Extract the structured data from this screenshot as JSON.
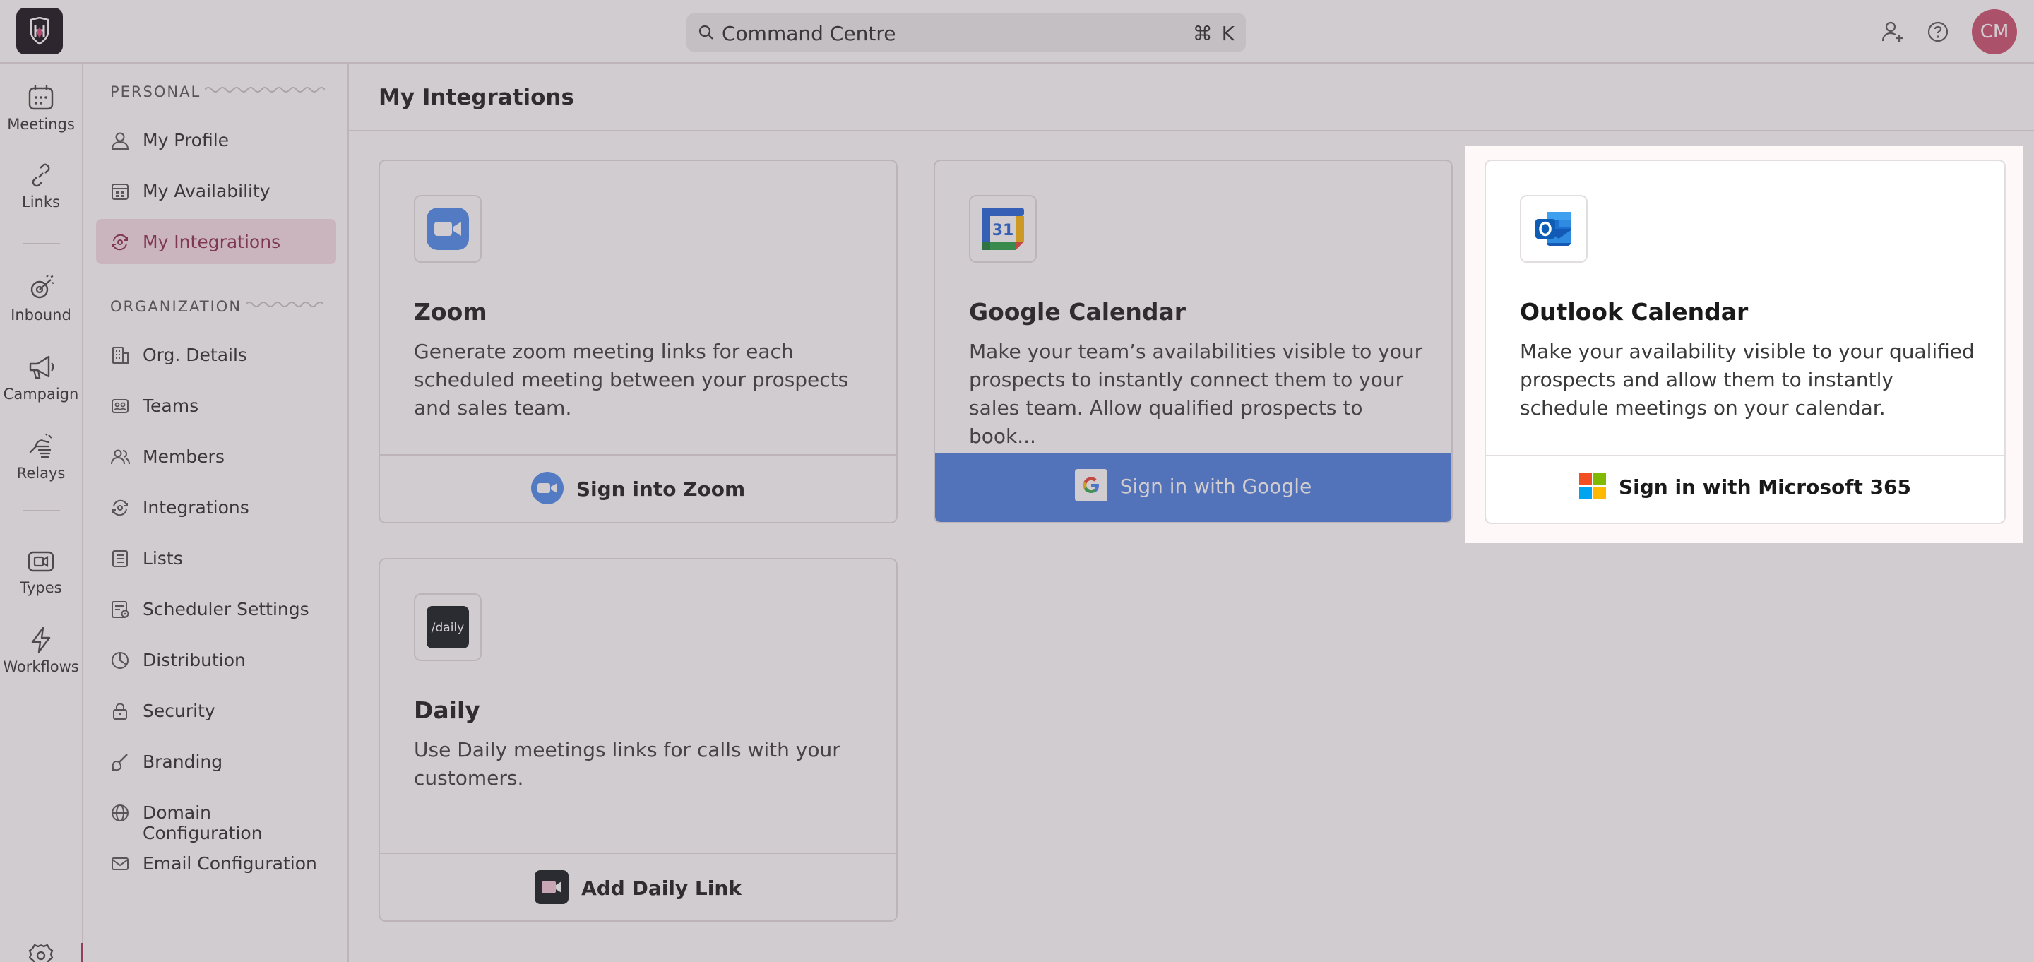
{
  "topbar": {
    "search_text": "Command Centre",
    "shortcut": "⌘ K",
    "avatar_initials": "CM",
    "icons": [
      "logo-icon",
      "search-icon",
      "add-user-icon",
      "help-icon"
    ]
  },
  "rail": {
    "items": [
      {
        "label": "Meetings",
        "icon": "calendar-icon"
      },
      {
        "label": "Links",
        "icon": "link-icon"
      },
      {
        "label": "Inbound",
        "icon": "cursor-click-icon"
      },
      {
        "label": "Campaign",
        "icon": "megaphone-icon"
      },
      {
        "label": "Relays",
        "icon": "hand-icon"
      },
      {
        "label": "Types",
        "icon": "video-icon"
      },
      {
        "label": "Workflows",
        "icon": "bolt-icon"
      }
    ],
    "bottom_icon": "settings-icon"
  },
  "sidebar": {
    "personal_heading": "PERSONAL",
    "organization_heading": "ORGANIZATION",
    "personal": [
      {
        "label": "My Profile",
        "icon": "user-icon"
      },
      {
        "label": "My Availability",
        "icon": "calendar-grid-icon"
      },
      {
        "label": "My Integrations",
        "icon": "integrations-icon",
        "active": true
      }
    ],
    "organization": [
      {
        "label": "Org. Details",
        "icon": "building-icon"
      },
      {
        "label": "Teams",
        "icon": "teams-icon"
      },
      {
        "label": "Members",
        "icon": "members-icon"
      },
      {
        "label": "Integrations",
        "icon": "integrations-icon"
      },
      {
        "label": "Lists",
        "icon": "list-icon"
      },
      {
        "label": "Scheduler Settings",
        "icon": "scheduler-icon"
      },
      {
        "label": "Distribution",
        "icon": "pie-icon"
      },
      {
        "label": "Security",
        "icon": "lock-icon"
      },
      {
        "label": "Branding",
        "icon": "brush-icon"
      },
      {
        "label": "Domain Configuration",
        "icon": "globe-icon"
      },
      {
        "label": "Email Configuration",
        "icon": "mail-icon"
      }
    ]
  },
  "main": {
    "title": "My Integrations",
    "cards": [
      {
        "title": "Zoom",
        "description": "Generate zoom meeting links for each scheduled meeting between your prospects and sales team.",
        "button": "Sign into Zoom",
        "icon": "zoom-icon"
      },
      {
        "title": "Google Calendar",
        "description": "Make your team’s availabilities visible to your prospects to instantly connect them to your sales team. Allow qualified prospects to book...",
        "button": "Sign in with Google",
        "icon": "google-calendar-icon",
        "calendar_day": "31"
      },
      {
        "title": "Outlook Calendar",
        "description": "Make your availability visible to your qualified prospects and allow them to instantly schedule meetings on your calendar.",
        "button": "Sign in with Microsoft 365",
        "icon": "outlook-icon",
        "highlighted": true
      },
      {
        "title": "Daily",
        "description": "Use Daily meetings links for calls with your customers.",
        "button": "Add Daily Link",
        "icon": "daily-icon",
        "logo_text": "/daily"
      }
    ]
  },
  "colors": {
    "accent": "#a4355a",
    "active_bg": "#f5dde6",
    "google_button": "#4a7fe0",
    "avatar": "#c9516f"
  }
}
